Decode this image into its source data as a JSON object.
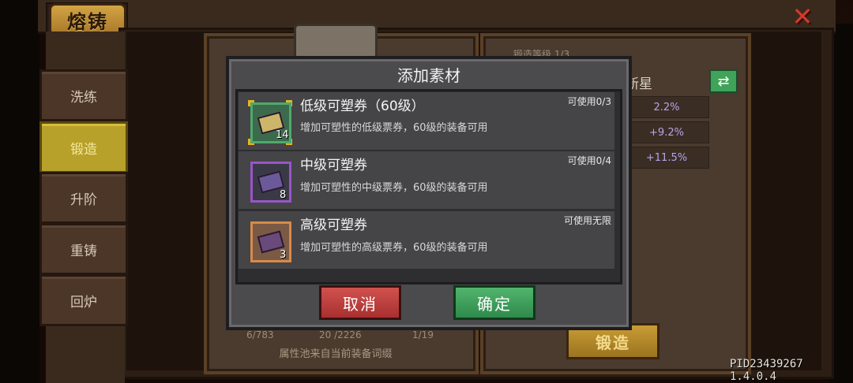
{
  "header": {
    "title": "熔铸",
    "close_icon": "close-x-icon"
  },
  "sidebar": {
    "tabs": [
      {
        "label": "洗练",
        "active": false
      },
      {
        "label": "锻造",
        "active": true
      },
      {
        "label": "升阶",
        "active": false
      },
      {
        "label": "重铸",
        "active": false
      },
      {
        "label": "回炉",
        "active": false
      }
    ]
  },
  "right_panel": {
    "header_partial": "锻造等级 1/3",
    "star_label": "新星",
    "refresh_icon": "refresh-icon",
    "stats": [
      "2.2%",
      "+9.2%",
      "+11.5%"
    ],
    "forge_button": "锻造"
  },
  "left_panel": {
    "stats": [
      "6/783",
      "20 /2226",
      "1/19"
    ],
    "pool_note": "属性池来自当前装备词缀"
  },
  "modal": {
    "title": "添加素材",
    "items": [
      {
        "name": "低级可塑券（60级）",
        "desc": "增加可塑性的低级票券，60级的装备可用",
        "avail": "可使用0/3",
        "count": "14",
        "tier_color": "#4faa6a"
      },
      {
        "name": "中级可塑券",
        "desc": "增加可塑性的中级票券，60级的装备可用",
        "avail": "可使用0/4",
        "count": "8",
        "tier_color": "#9a54c8"
      },
      {
        "name": "高级可塑券",
        "desc": "增加可塑性的高级票券，60级的装备可用",
        "avail": "可使用无限",
        "count": "3",
        "tier_color": "#d88a4a"
      }
    ],
    "cancel_label": "取消",
    "confirm_label": "确定"
  },
  "footer": {
    "pid": "PID23439267 1.4.0.4"
  }
}
